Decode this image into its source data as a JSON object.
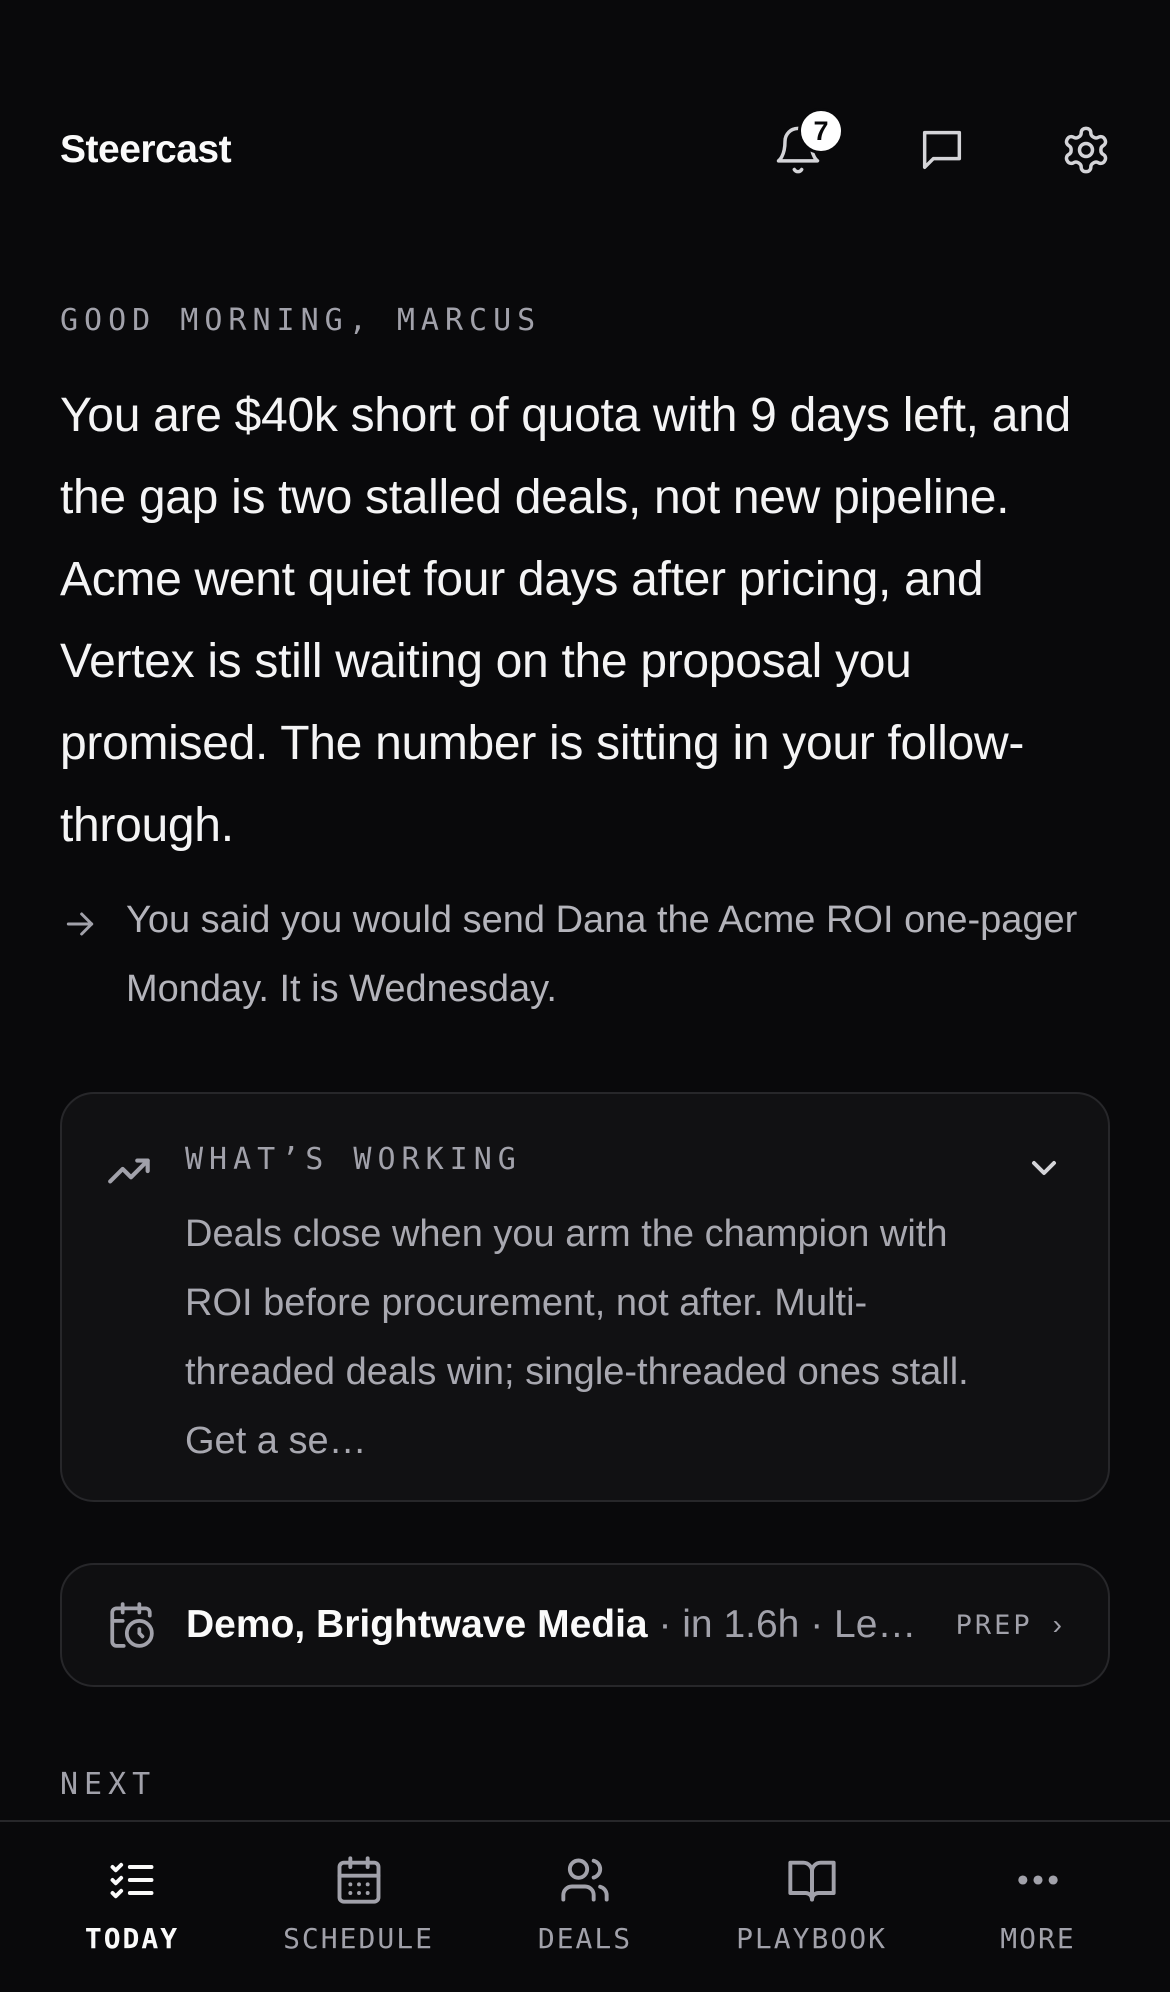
{
  "app": {
    "brand": "Steercast"
  },
  "header": {
    "notifications_count": "7",
    "icons": [
      "bell-icon",
      "message-icon",
      "gear-icon"
    ]
  },
  "briefing": {
    "greeting": "GOOD MORNING, MARCUS",
    "headline": "You are $40k short of quota with 9 days left, and the gap is two stalled deals, not new pipeline. Acme went quiet four days after pricing, and Vertex is still waiting on the proposal you promised. The number is sitting in your follow-through.",
    "nudge": "You said you would send Dana the Acme ROI one-pager Monday. It is Wednesday."
  },
  "working": {
    "label": "WHAT’S WORKING",
    "body": "Deals close when you arm the champion with ROI before procurement, not after. Multi-threaded deals win; single-threaded ones stall. Get a se…"
  },
  "event": {
    "title": "Demo, Brightwave Media",
    "meta": " · in 1.6h · Le…",
    "action": "PREP",
    "chevron": "›"
  },
  "next": {
    "label": "NEXT"
  },
  "nav": {
    "items": [
      {
        "label": "TODAY",
        "icon": "today-checklist-icon",
        "active": true
      },
      {
        "label": "SCHEDULE",
        "icon": "calendar-icon",
        "active": false
      },
      {
        "label": "DEALS",
        "icon": "users-icon",
        "active": false
      },
      {
        "label": "PLAYBOOK",
        "icon": "book-icon",
        "active": false
      },
      {
        "label": "MORE",
        "icon": "more-dots-icon",
        "active": false
      }
    ]
  },
  "colors": {
    "background": "#09090b",
    "card": "#111113",
    "border": "#27272a",
    "muted": "#a1a1aa"
  }
}
